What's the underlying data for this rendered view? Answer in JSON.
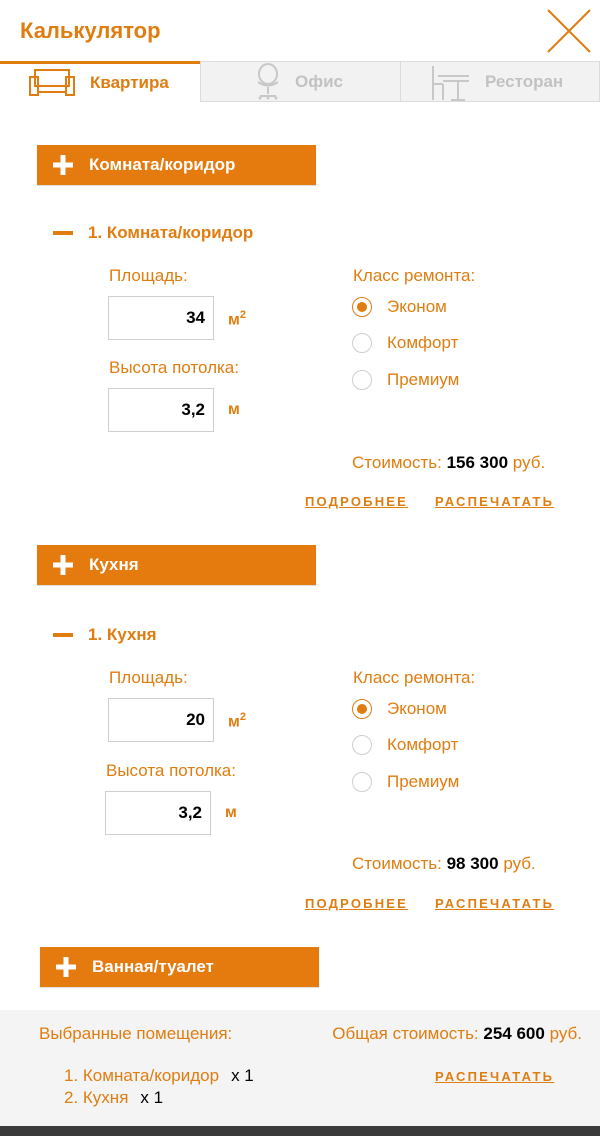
{
  "header": {
    "title": "Калькулятор"
  },
  "tabs": [
    {
      "label": "Квартира",
      "icon": "sofa-icon",
      "active": true
    },
    {
      "label": "Офис",
      "icon": "office-chair-icon",
      "active": false
    },
    {
      "label": "Ресторан",
      "icon": "restaurant-table-icon",
      "active": false
    }
  ],
  "accent_color": "#e57a0e",
  "sections": [
    {
      "add_label": "Комната/коридор",
      "room": {
        "title": "1. Комната/коридор",
        "area_label": "Площадь:",
        "area_value": "34",
        "area_unit": "м",
        "area_unit_sup": "2",
        "height_label": "Высота потолка:",
        "height_value": "3,2",
        "height_unit": "м",
        "class_label": "Класс ремонта:",
        "options": [
          "Эконом",
          "Комфорт",
          "Премиум"
        ],
        "selected": "Эконом",
        "cost_label": "Стоимость:",
        "cost_value": "156 300",
        "cost_currency": "руб.",
        "details_link": "ПОДРОБНЕЕ",
        "print_link": "РАСПЕЧАТАТЬ"
      }
    },
    {
      "add_label": "Кухня",
      "room": {
        "title": "1. Кухня",
        "area_label": "Площадь:",
        "area_value": "20",
        "area_unit": "м",
        "area_unit_sup": "2",
        "height_label": "Высота потолка:",
        "height_value": "3,2",
        "height_unit": "м",
        "class_label": "Класс ремонта:",
        "options": [
          "Эконом",
          "Комфорт",
          "Премиум"
        ],
        "selected": "Эконом",
        "cost_label": "Стоимость:",
        "cost_value": "98 300",
        "cost_currency": "руб.",
        "details_link": "ПОДРОБНЕЕ",
        "print_link": "РАСПЕЧАТАТЬ"
      }
    },
    {
      "add_label": "Ванная/туалет"
    }
  ],
  "footer": {
    "selected_title": "Выбранные помещения:",
    "total_label": "Общая стоимость:",
    "total_value": "254 600",
    "total_currency": "руб.",
    "items": [
      {
        "label": "1. Комната/коридор",
        "qty": "x 1"
      },
      {
        "label": "2. Кухня",
        "qty": "x 1"
      }
    ],
    "print_link": "РАСПЕЧАТАТЬ"
  }
}
